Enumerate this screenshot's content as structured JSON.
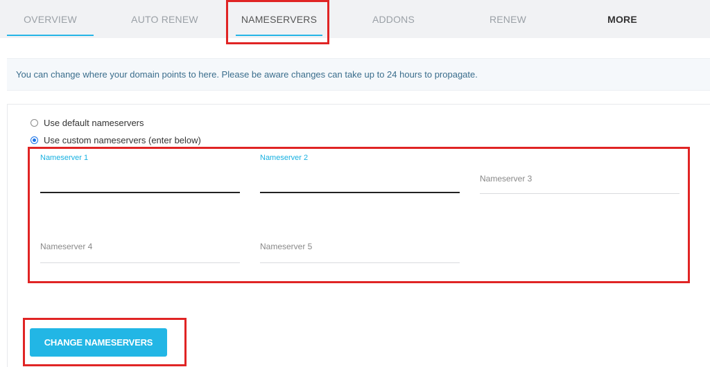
{
  "tabs": [
    {
      "label": "OVERVIEW"
    },
    {
      "label": "AUTO RENEW"
    },
    {
      "label": "NAMESERVERS"
    },
    {
      "label": "ADDONS"
    },
    {
      "label": "RENEW"
    },
    {
      "label": "MORE"
    }
  ],
  "active_tab": "NAMESERVERS",
  "banner": {
    "text": "You can change where your domain points to here. Please be aware changes can take up to 24 hours to propagate."
  },
  "options": {
    "default": {
      "label": "Use default nameservers",
      "checked": false
    },
    "custom": {
      "label": "Use custom nameservers (enter below)",
      "checked": true
    }
  },
  "fields": {
    "ns1": {
      "label": "Nameserver 1",
      "value": ""
    },
    "ns2": {
      "label": "Nameserver 2",
      "value": ""
    },
    "ns3": {
      "placeholder": "Nameserver 3",
      "value": ""
    },
    "ns4": {
      "placeholder": "Nameserver 4",
      "value": ""
    },
    "ns5": {
      "placeholder": "Nameserver 5",
      "value": ""
    }
  },
  "submit": {
    "label": "CHANGE NAMESERVERS"
  },
  "colors": {
    "accent": "#22b6e5",
    "highlight": "#e02424",
    "radio_checked": "#1a73e8"
  }
}
